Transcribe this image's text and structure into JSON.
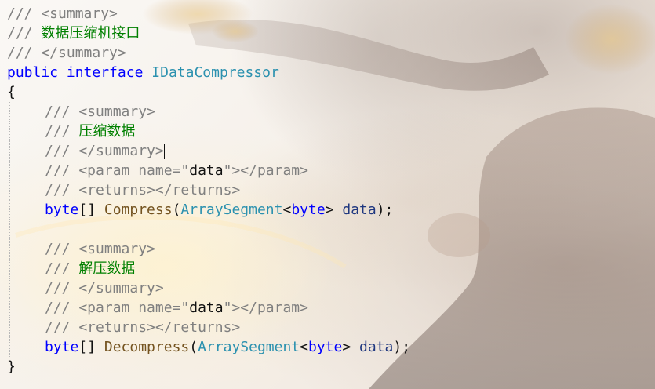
{
  "editor": {
    "lines": [
      {
        "indent": false,
        "tokens": [
          {
            "cls": "cmt",
            "text": "/// <summary>"
          }
        ]
      },
      {
        "indent": false,
        "tokens": [
          {
            "cls": "cmt",
            "text": "/// "
          },
          {
            "cls": "ctext",
            "text": "数据压缩机接口"
          }
        ]
      },
      {
        "indent": false,
        "tokens": [
          {
            "cls": "cmt",
            "text": "/// </summary>"
          }
        ]
      },
      {
        "indent": false,
        "tokens": [
          {
            "cls": "kw",
            "text": "public"
          },
          {
            "cls": "plain",
            "text": " "
          },
          {
            "cls": "kw",
            "text": "interface"
          },
          {
            "cls": "plain",
            "text": " "
          },
          {
            "cls": "type",
            "text": "IDataCompressor"
          }
        ]
      },
      {
        "indent": false,
        "tokens": [
          {
            "cls": "plain",
            "text": "{"
          }
        ]
      },
      {
        "indent": true,
        "tokens": [
          {
            "cls": "cmt",
            "text": "/// <summary>"
          }
        ]
      },
      {
        "indent": true,
        "tokens": [
          {
            "cls": "cmt",
            "text": "/// "
          },
          {
            "cls": "ctext",
            "text": "压缩数据"
          }
        ]
      },
      {
        "indent": true,
        "caret": true,
        "tokens": [
          {
            "cls": "cmt",
            "text": "/// </summary>"
          }
        ]
      },
      {
        "indent": true,
        "tokens": [
          {
            "cls": "cmt",
            "text": "/// <param name=\""
          },
          {
            "cls": "plain",
            "text": "data"
          },
          {
            "cls": "cmt",
            "text": "\"></param>"
          }
        ]
      },
      {
        "indent": true,
        "tokens": [
          {
            "cls": "cmt",
            "text": "/// <returns></returns>"
          }
        ]
      },
      {
        "indent": true,
        "tokens": [
          {
            "cls": "kw",
            "text": "byte"
          },
          {
            "cls": "plain",
            "text": "[] "
          },
          {
            "cls": "method",
            "text": "Compress"
          },
          {
            "cls": "plain",
            "text": "("
          },
          {
            "cls": "type",
            "text": "ArraySegment"
          },
          {
            "cls": "plain",
            "text": "<"
          },
          {
            "cls": "kw",
            "text": "byte"
          },
          {
            "cls": "plain",
            "text": "> "
          },
          {
            "cls": "str",
            "text": "data"
          },
          {
            "cls": "plain",
            "text": ");"
          }
        ]
      },
      {
        "indent": true,
        "tokens": []
      },
      {
        "indent": true,
        "tokens": [
          {
            "cls": "cmt",
            "text": "/// <summary>"
          }
        ]
      },
      {
        "indent": true,
        "tokens": [
          {
            "cls": "cmt",
            "text": "/// "
          },
          {
            "cls": "ctext",
            "text": "解压数据"
          }
        ]
      },
      {
        "indent": true,
        "tokens": [
          {
            "cls": "cmt",
            "text": "/// </summary>"
          }
        ]
      },
      {
        "indent": true,
        "tokens": [
          {
            "cls": "cmt",
            "text": "/// <param name=\""
          },
          {
            "cls": "plain",
            "text": "data"
          },
          {
            "cls": "cmt",
            "text": "\"></param>"
          }
        ]
      },
      {
        "indent": true,
        "tokens": [
          {
            "cls": "cmt",
            "text": "/// <returns></returns>"
          }
        ]
      },
      {
        "indent": true,
        "tokens": [
          {
            "cls": "kw",
            "text": "byte"
          },
          {
            "cls": "plain",
            "text": "[] "
          },
          {
            "cls": "method",
            "text": "Decompress"
          },
          {
            "cls": "plain",
            "text": "("
          },
          {
            "cls": "type",
            "text": "ArraySegment"
          },
          {
            "cls": "plain",
            "text": "<"
          },
          {
            "cls": "kw",
            "text": "byte"
          },
          {
            "cls": "plain",
            "text": "> "
          },
          {
            "cls": "str",
            "text": "data"
          },
          {
            "cls": "plain",
            "text": ");"
          }
        ]
      },
      {
        "indent": false,
        "tokens": [
          {
            "cls": "plain",
            "text": "}"
          }
        ]
      }
    ]
  }
}
